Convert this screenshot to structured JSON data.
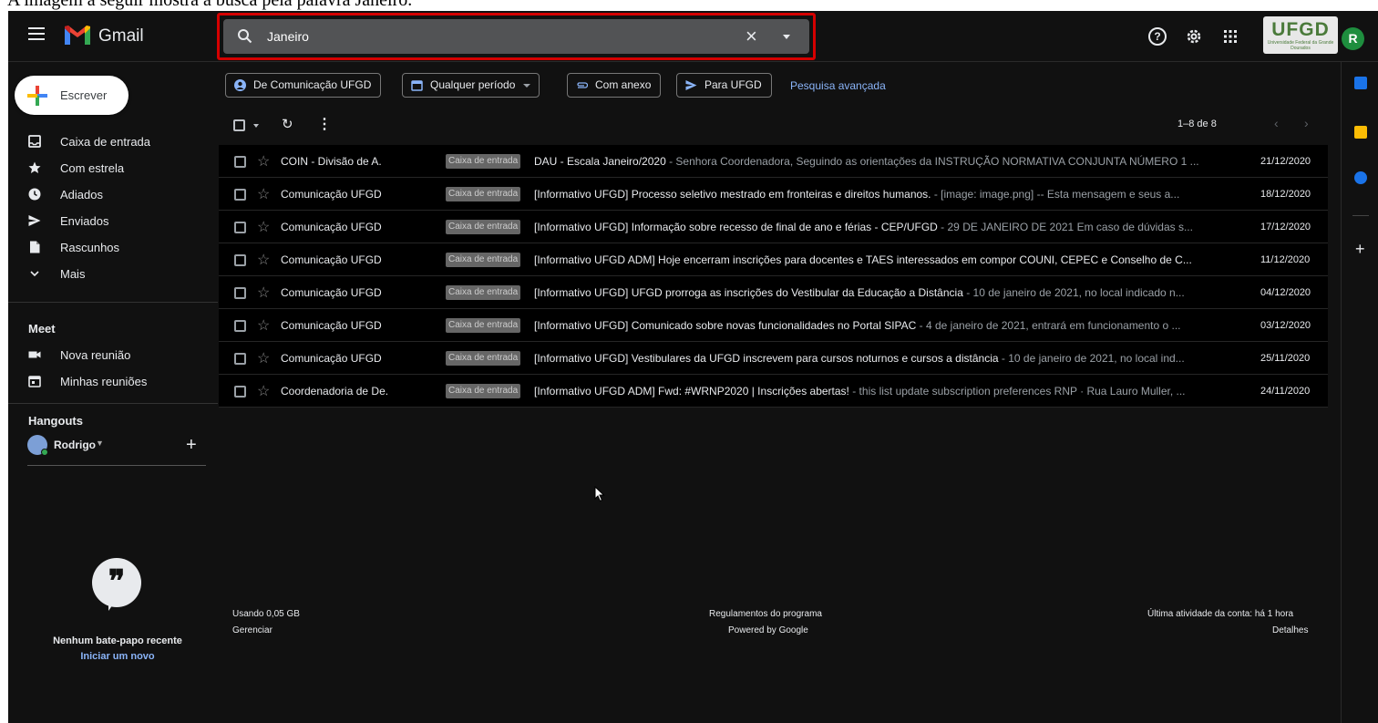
{
  "caption": "A imagem a seguir mostra a busca pela palavra Janeiro.",
  "app": {
    "name": "Gmail"
  },
  "search": {
    "value": "Janeiro",
    "clear_icon": "close-icon",
    "options_icon": "caret-down-icon"
  },
  "org_logo": {
    "name": "UFGD",
    "tagline": "Universidade Federal da Grande Dourados"
  },
  "user": {
    "initial": "R"
  },
  "compose": {
    "label": "Escrever"
  },
  "nav": [
    {
      "label": "Caixa de entrada",
      "icon": "inbox-icon"
    },
    {
      "label": "Com estrela",
      "icon": "star-icon"
    },
    {
      "label": "Adiados",
      "icon": "clock-icon"
    },
    {
      "label": "Enviados",
      "icon": "send-icon"
    },
    {
      "label": "Rascunhos",
      "icon": "draft-icon"
    },
    {
      "label": "Mais",
      "icon": "chevron-down-icon"
    }
  ],
  "meet": {
    "title": "Meet",
    "items": [
      {
        "label": "Nova reunião",
        "icon": "video-icon"
      },
      {
        "label": "Minhas reuniões",
        "icon": "calendar-icon"
      }
    ]
  },
  "hangouts": {
    "title": "Hangouts",
    "user": "Rodrigo",
    "empty_text": "Nenhum bate-papo recente",
    "start_link": "Iniciar um novo"
  },
  "chips": [
    {
      "label": "De Comunicação UFGD",
      "icon": "person-icon"
    },
    {
      "label": "Qualquer período",
      "icon": "calendar-icon"
    },
    {
      "label": "Com anexo",
      "icon": "attachment-icon"
    },
    {
      "label": "Para UFGD",
      "icon": "send-icon"
    }
  ],
  "advanced_search": "Pesquisa avançada",
  "pagination": {
    "text": "1–8 de 8"
  },
  "emails": [
    {
      "from": "COIN - Divisão de A.",
      "label": "Caixa de entrada",
      "subject": "DAU - Escala Janeiro/2020",
      "snippet": " - Senhora Coordenadora, Seguindo as orientações da INSTRUÇÃO NORMATIVA CONJUNTA NÚMERO 1 ...",
      "date": "21/12/2020"
    },
    {
      "from": "Comunicação UFGD",
      "label": "Caixa de entrada",
      "subject": "[Informativo UFGD] Processo seletivo mestrado em fronteiras e direitos humanos.",
      "snippet": " - [image: image.png] -- Esta mensagem e seus a...",
      "date": "18/12/2020"
    },
    {
      "from": "Comunicação UFGD",
      "label": "Caixa de entrada",
      "subject": "[Informativo UFGD] Informação sobre recesso de final de ano e férias - CEP/UFGD",
      "snippet": " - 29 DE JANEIRO DE 2021 Em caso de dúvidas s...",
      "date": "17/12/2020"
    },
    {
      "from": "Comunicação UFGD",
      "label": "Caixa de entrada",
      "subject": "[Informativo UFGD ADM] Hoje encerram inscrições para docentes e TAES interessados em compor COUNI, CEPEC e Conselho de C...",
      "snippet": "",
      "date": "11/12/2020"
    },
    {
      "from": "Comunicação UFGD",
      "label": "Caixa de entrada",
      "subject": "[Informativo UFGD] UFGD prorroga as inscrições do Vestibular da Educação a Distância",
      "snippet": " - 10 de janeiro de 2021, no local indicado n...",
      "date": "04/12/2020"
    },
    {
      "from": "Comunicação UFGD",
      "label": "Caixa de entrada",
      "subject": "[Informativo UFGD] Comunicado sobre novas funcionalidades no Portal SIPAC",
      "snippet": " - 4 de janeiro de 2021, entrará em funcionamento o ...",
      "date": "03/12/2020"
    },
    {
      "from": "Comunicação UFGD",
      "label": "Caixa de entrada",
      "subject": "[Informativo UFGD] Vestibulares da UFGD inscrevem para cursos noturnos e cursos a distância",
      "snippet": " - 10 de janeiro de 2021, no local ind...",
      "date": "25/11/2020"
    },
    {
      "from": "Coordenadoria de De.",
      "label": "Caixa de entrada",
      "subject": "[Informativo UFGD ADM] Fwd: #WRNP2020 | Inscrições abertas!",
      "snippet": " - this list update subscription preferences RNP · Rua Lauro Muller, ...",
      "date": "24/11/2020"
    }
  ],
  "footer": {
    "storage": "Usando 0,05 GB",
    "manage": "Gerenciar",
    "policies": "Regulamentos do programa",
    "powered": "Powered by Google",
    "activity": "Última atividade da conta: há 1 hora",
    "details": "Detalhes"
  },
  "colors": {
    "background": "#111111",
    "accent_link": "#8ab4f8",
    "highlight_border": "#d50000",
    "avatar": "#1e8e3e"
  }
}
